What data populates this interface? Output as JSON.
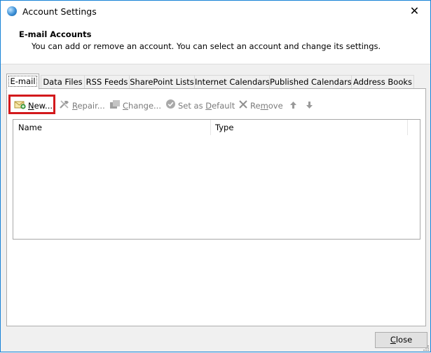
{
  "window": {
    "title": "Account Settings",
    "close_glyph": "✕"
  },
  "header": {
    "title": "E-mail Accounts",
    "description": "You can add or remove an account. You can select an account and change its settings."
  },
  "tabs": [
    {
      "label": "E-mail",
      "active": true
    },
    {
      "label": "Data Files"
    },
    {
      "label": "RSS Feeds"
    },
    {
      "label": "SharePoint Lists"
    },
    {
      "label": "Internet Calendars"
    },
    {
      "label": "Published Calendars"
    },
    {
      "label": "Address Books"
    }
  ],
  "toolbar": {
    "new": {
      "prefix": "",
      "accel": "N",
      "rest": "ew...",
      "icon": "new-account-icon"
    },
    "repair": {
      "prefix": "",
      "accel": "R",
      "rest": "epair...",
      "icon": "repair-icon"
    },
    "change": {
      "prefix": "",
      "accel": "C",
      "rest": "hange...",
      "icon": "change-icon"
    },
    "set_default": {
      "prefix": "Set as ",
      "accel": "D",
      "rest": "efault",
      "icon": "checkmark-icon"
    },
    "remove": {
      "prefix": "Re",
      "accel": "m",
      "rest": "ove",
      "icon": "remove-icon"
    },
    "move_up_icon": "arrow-up-icon",
    "move_down_icon": "arrow-down-icon"
  },
  "list": {
    "columns": [
      "Name",
      "Type"
    ],
    "rows": []
  },
  "footer": {
    "close": {
      "accel": "C",
      "rest": "lose"
    }
  },
  "colors": {
    "highlight": "#d3191c",
    "window_border": "#1883d7"
  }
}
